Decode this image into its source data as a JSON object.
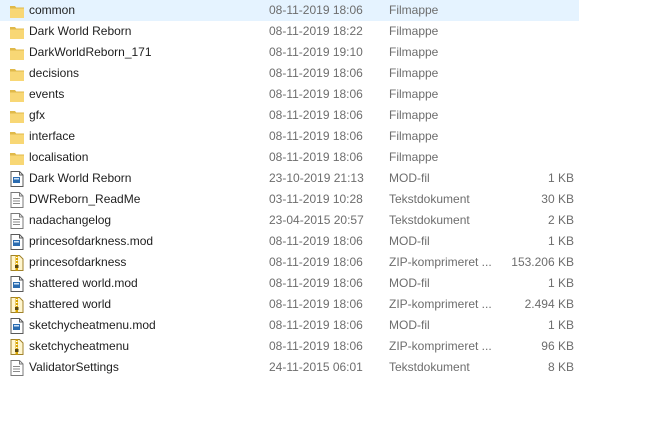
{
  "files": [
    {
      "name": "common",
      "date": "08-11-2019 18:06",
      "type": "Filmappe",
      "size": "",
      "icon": "folder-icon",
      "selected": true
    },
    {
      "name": "Dark World Reborn",
      "date": "08-11-2019 18:22",
      "type": "Filmappe",
      "size": "",
      "icon": "folder-icon"
    },
    {
      "name": "DarkWorldReborn_171",
      "date": "08-11-2019 19:10",
      "type": "Filmappe",
      "size": "",
      "icon": "folder-icon"
    },
    {
      "name": "decisions",
      "date": "08-11-2019 18:06",
      "type": "Filmappe",
      "size": "",
      "icon": "folder-icon"
    },
    {
      "name": "events",
      "date": "08-11-2019 18:06",
      "type": "Filmappe",
      "size": "",
      "icon": "folder-icon"
    },
    {
      "name": "gfx",
      "date": "08-11-2019 18:06",
      "type": "Filmappe",
      "size": "",
      "icon": "folder-icon"
    },
    {
      "name": "interface",
      "date": "08-11-2019 18:06",
      "type": "Filmappe",
      "size": "",
      "icon": "folder-icon"
    },
    {
      "name": "localisation",
      "date": "08-11-2019 18:06",
      "type": "Filmappe",
      "size": "",
      "icon": "folder-icon"
    },
    {
      "name": "Dark World Reborn",
      "date": "23-10-2019 21:13",
      "type": "MOD-fil",
      "size": "1 KB",
      "icon": "mod-file-icon"
    },
    {
      "name": "DWReborn_ReadMe",
      "date": "03-11-2019 10:28",
      "type": "Tekstdokument",
      "size": "30 KB",
      "icon": "text-file-icon"
    },
    {
      "name": "nadachangelog",
      "date": "23-04-2015 20:57",
      "type": "Tekstdokument",
      "size": "2 KB",
      "icon": "text-file-icon"
    },
    {
      "name": "princesofdarkness.mod",
      "date": "08-11-2019 18:06",
      "type": "MOD-fil",
      "size": "1 KB",
      "icon": "mod-file-icon"
    },
    {
      "name": "princesofdarkness",
      "date": "08-11-2019 18:06",
      "type": "ZIP-komprimeret ...",
      "size": "153.206 KB",
      "icon": "zip-file-icon"
    },
    {
      "name": "shattered world.mod",
      "date": "08-11-2019 18:06",
      "type": "MOD-fil",
      "size": "1 KB",
      "icon": "mod-file-icon"
    },
    {
      "name": "shattered world",
      "date": "08-11-2019 18:06",
      "type": "ZIP-komprimeret ...",
      "size": "2.494 KB",
      "icon": "zip-file-icon"
    },
    {
      "name": "sketchycheatmenu.mod",
      "date": "08-11-2019 18:06",
      "type": "MOD-fil",
      "size": "1 KB",
      "icon": "mod-file-icon"
    },
    {
      "name": "sketchycheatmenu",
      "date": "08-11-2019 18:06",
      "type": "ZIP-komprimeret ...",
      "size": "96 KB",
      "icon": "zip-file-icon"
    },
    {
      "name": "ValidatorSettings",
      "date": "24-11-2015 06:01",
      "type": "Tekstdokument",
      "size": "8 KB",
      "icon": "text-file-icon"
    }
  ],
  "colors": {
    "selected_row": "#e5f3ff",
    "folder": "#f8d775",
    "folder_dark": "#e0b94a",
    "mod_accent": "#2b6cb0",
    "zip_accent": "#d9a400",
    "muted_text": "#6d6d6d"
  }
}
